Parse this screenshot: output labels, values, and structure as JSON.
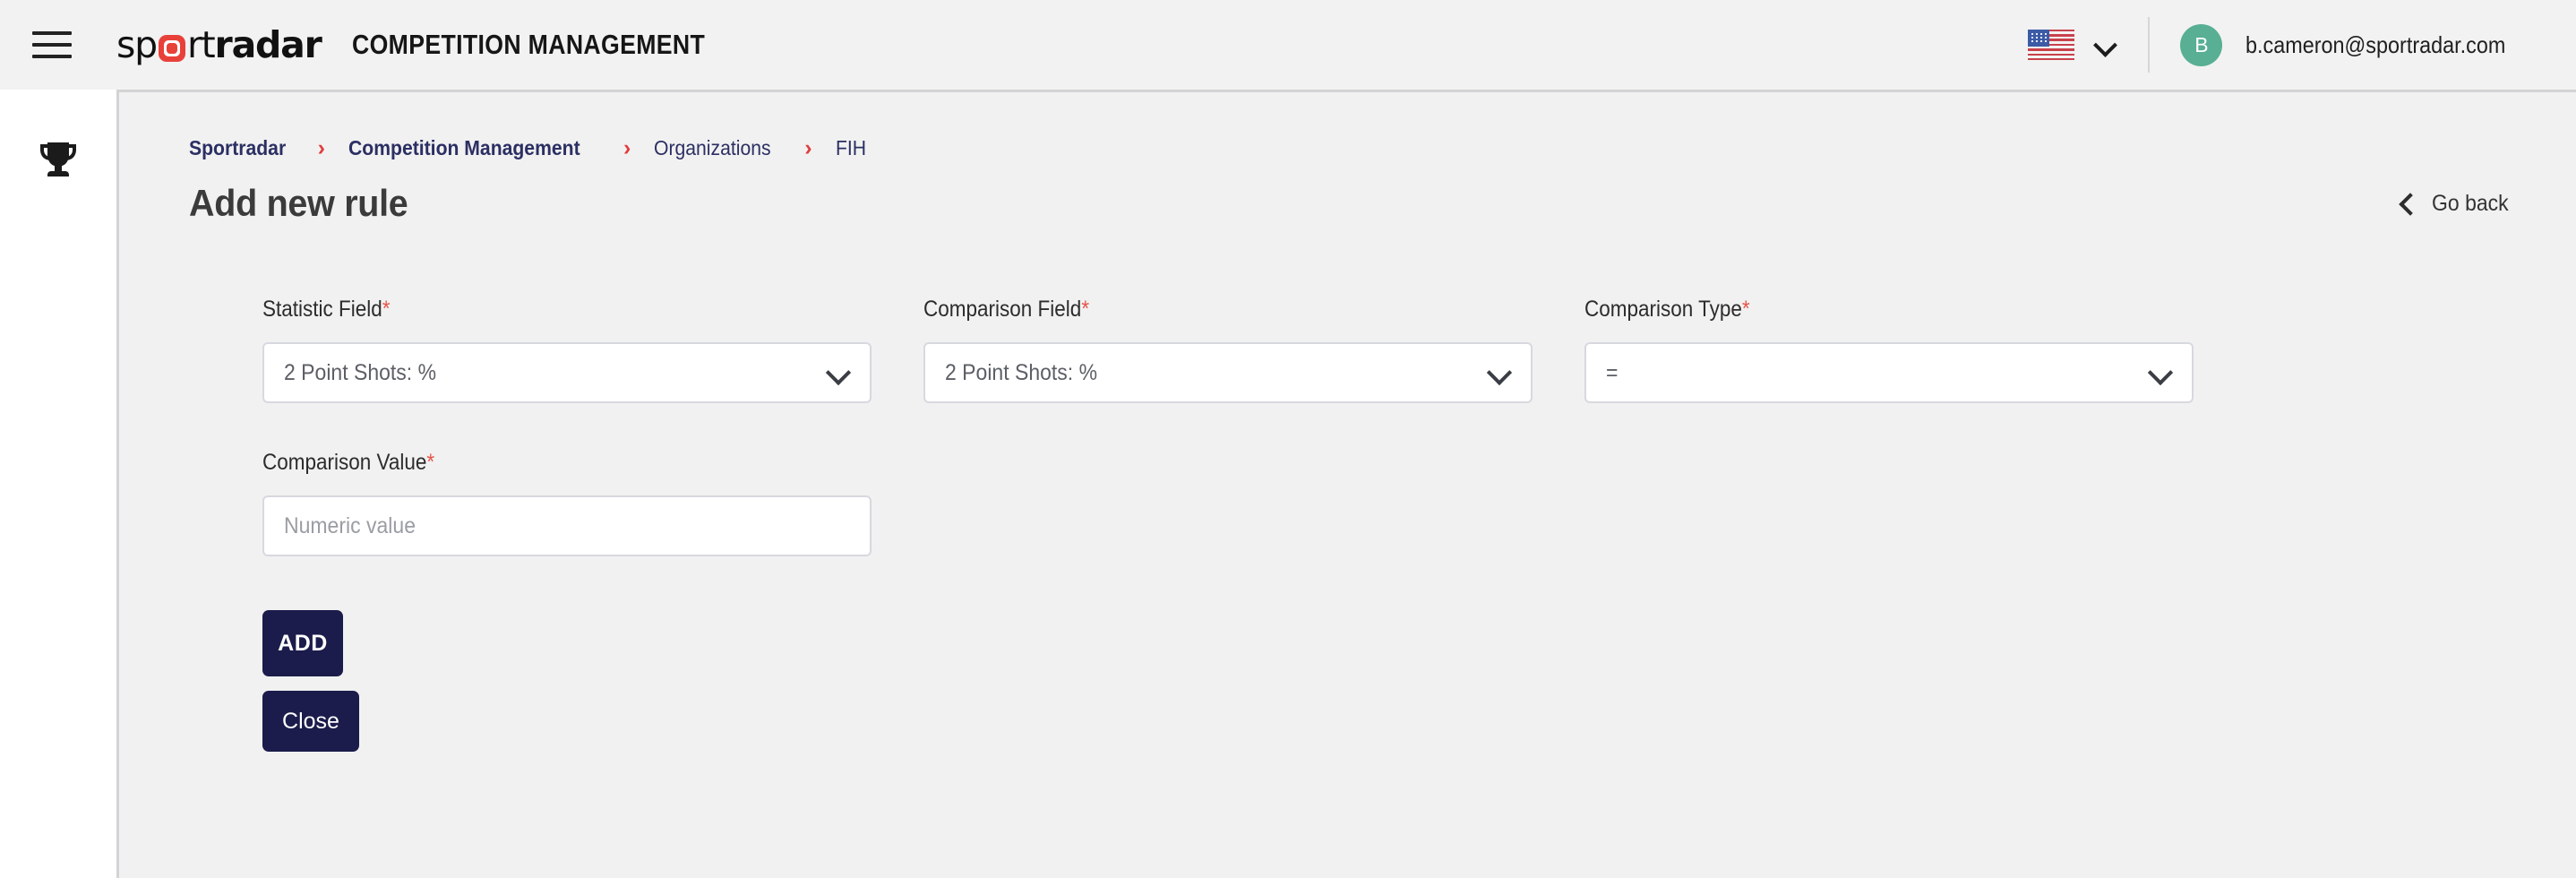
{
  "header": {
    "menu_icon": "hamburger-icon",
    "logo_text_1": "sp",
    "logo_text_2": "rt",
    "logo_text_3": "radar",
    "app_title": "COMPETITION MANAGEMENT",
    "language_flag": "us-flag-icon",
    "language_chevron": "chevron-down-icon",
    "avatar_initial": "B",
    "user_email": "b.cameron@sportradar.com",
    "avatar_color": "#58af93",
    "accent_red": "#e8413a"
  },
  "sidebar": {
    "items": [
      {
        "icon": "trophy-icon",
        "label": "Competitions"
      }
    ]
  },
  "breadcrumb": {
    "separator": "›",
    "items": [
      {
        "label": "Sportradar",
        "bold": true
      },
      {
        "label": "Competition Management",
        "bold": true
      },
      {
        "label": "Organizations",
        "bold": false
      },
      {
        "label": "FIH",
        "bold": false
      }
    ]
  },
  "page": {
    "title": "Add new rule",
    "go_back_label": "Go back",
    "go_back_icon": "chevron-left-icon"
  },
  "form": {
    "required_marker": "*",
    "fields": [
      {
        "name": "statistic-field",
        "label": "Statistic Field",
        "required": true,
        "type": "select",
        "value": "2 Point Shots: %",
        "icon": "chevron-down-icon"
      },
      {
        "name": "comparison-field",
        "label": "Comparison Field",
        "required": true,
        "type": "select",
        "value": "2 Point Shots: %",
        "icon": "chevron-down-icon"
      },
      {
        "name": "comparison-type",
        "label": "Comparison Type",
        "required": true,
        "type": "select",
        "value": "=",
        "icon": "chevron-down-icon"
      },
      {
        "name": "comparison-value",
        "label": "Comparison Value",
        "required": true,
        "type": "text",
        "value": "",
        "placeholder": "Numeric value"
      }
    ],
    "buttons": {
      "add_label": "ADD",
      "close_label": "Close",
      "button_color": "#1b1c4b"
    }
  }
}
